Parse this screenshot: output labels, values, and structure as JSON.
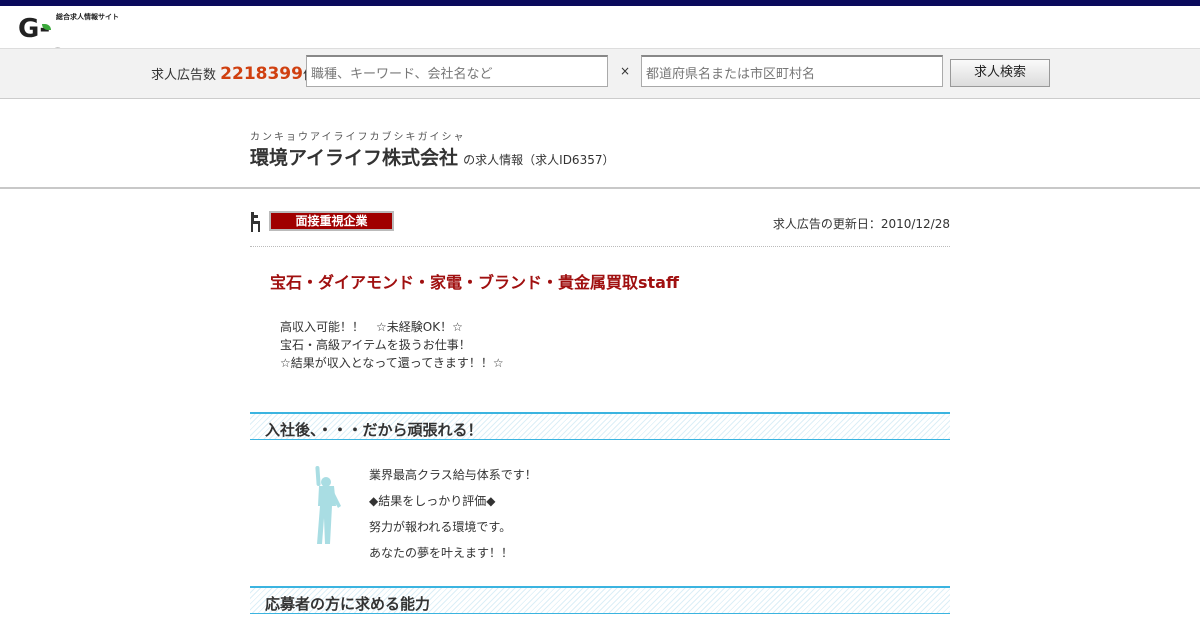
{
  "header": {
    "logo_tagline": "総合求人情報サイト",
    "logo_text": "G-WORK"
  },
  "search": {
    "count_prefix": "求人広告数",
    "count_value": "2218399",
    "count_suffix": "件",
    "keyword_placeholder": "職種、キーワード、会社名など",
    "separator": "×",
    "location_placeholder": "都道府県名または市区町村名",
    "button_label": "求人検索"
  },
  "company": {
    "kana": "カンキョウアイライフカブシキガイシャ",
    "name": "環境アイライフ株式会社",
    "suffix": "の求人情報（求人ID6357）"
  },
  "listing": {
    "badge": "面接重視企業",
    "updated": "求人広告の更新日：2010/12/28",
    "title": "宝石・ダイアモンド・家電・ブランド・貴金属買取staff",
    "catch_lines": [
      "高収入可能！！　☆未経験OK！☆",
      "宝石・高級アイテムを扱うお仕事！",
      "☆結果が収入となって還ってきます！！☆"
    ]
  },
  "sections": [
    {
      "heading": "入社後、・・・だから頑張れる！",
      "points": [
        "業界最高クラス給与体系です！",
        "◆結果をしっかり評価◆",
        "努力が報われる環境です。",
        "あなたの夢を叶えます！！"
      ]
    },
    {
      "heading": "応募者の方に求める能力"
    }
  ],
  "colors": {
    "topbar": "#0a0a5c",
    "accent_count": "#d04010",
    "badge": "#a00000",
    "title": "#a01010",
    "section_border": "#3bb4e0"
  }
}
